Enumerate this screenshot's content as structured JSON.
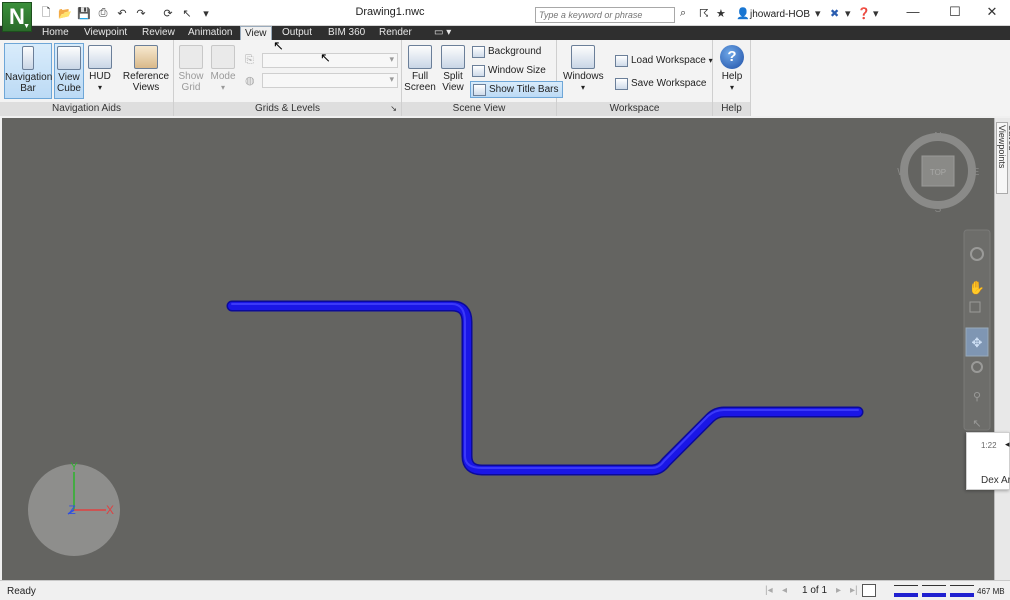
{
  "window": {
    "title": "Drawing1.nwc",
    "minimize": "—",
    "maximize": "☐",
    "close": "✕"
  },
  "app_logo": "N",
  "search": {
    "placeholder": "Type a keyword or phrase"
  },
  "user": {
    "name": "jhoward-HOB"
  },
  "tabs": [
    {
      "label": "Home"
    },
    {
      "label": "Viewpoint"
    },
    {
      "label": "Review"
    },
    {
      "label": "Animation"
    },
    {
      "label": "View",
      "active": true
    },
    {
      "label": "Output"
    },
    {
      "label": "BIM 360"
    },
    {
      "label": "Render"
    }
  ],
  "ribbon": {
    "navigation_aids": {
      "label": "Navigation Aids",
      "navigation_bar": "Navigation\nBar",
      "view_cube": "View\nCube",
      "hud": "HUD",
      "reference_views": "Reference\nViews"
    },
    "grids_levels": {
      "label": "Grids & Levels",
      "show_grid": "Show\nGrid",
      "mode": "Mode"
    },
    "scene_view": {
      "label": "Scene View",
      "full_screen": "Full\nScreen",
      "split_view": "Split\nView",
      "background": "Background",
      "window_size": "Window Size",
      "show_title_bars": "Show Title Bars"
    },
    "workspace": {
      "label": "Workspace",
      "windows": "Windows",
      "load_workspace": "Load Workspace",
      "save_workspace": "Save Workspace"
    },
    "help": {
      "label": "Help",
      "help": "Help"
    }
  },
  "viewcube": {
    "face": "TOP",
    "north": "N",
    "south": "S",
    "east": "E",
    "west": "W"
  },
  "axes": {
    "x": "X",
    "y": "Y",
    "z": "Z"
  },
  "side_tab": "Saved Viewpoints",
  "notification": {
    "time": "1:22",
    "title": "Dex Ar"
  },
  "status": {
    "ready": "Ready",
    "page": "1 of 1",
    "memory": "467 MB"
  },
  "colors": {
    "viewport_bg": "#646461",
    "pipe": "#1a16e6",
    "accent": "#3a8f3a"
  }
}
